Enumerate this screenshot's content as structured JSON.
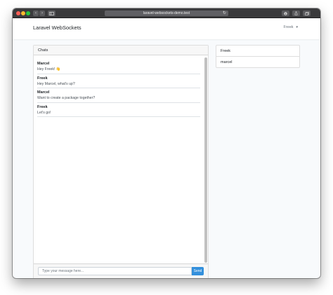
{
  "browser": {
    "url": "laravel-websockets-demo.test",
    "controls": {
      "back": "‹",
      "forward": "›",
      "reload": "↻"
    }
  },
  "navbar": {
    "brand": "Laravel WebSockets",
    "user": "Freek",
    "caret": "▼"
  },
  "chats": {
    "header": "Chats",
    "messages": [
      {
        "author": "Marcel",
        "text": "Hey Freek! 👋"
      },
      {
        "author": "Freek",
        "text": "Hey Marcel, what's up?"
      },
      {
        "author": "Marcel",
        "text": "Want to create a package together?"
      },
      {
        "author": "Freek",
        "text": "Let's go!"
      }
    ],
    "input": {
      "placeholder": "Type your message here..."
    },
    "send_label": "Send"
  },
  "users": [
    "Freek",
    "marcel"
  ],
  "colors": {
    "accent": "#3490dc",
    "page_background": "#f8fafc",
    "browser_chrome": "#3a3a3c"
  }
}
